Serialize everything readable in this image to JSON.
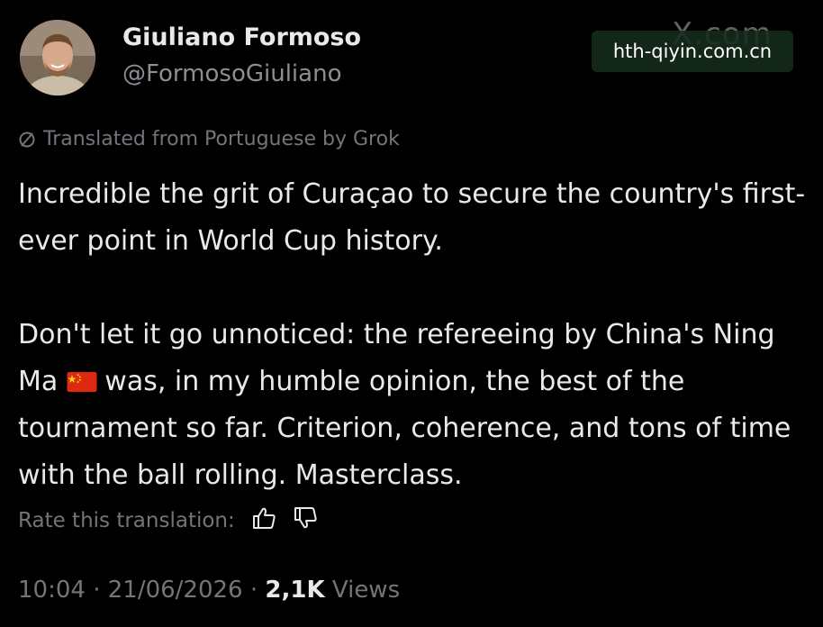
{
  "author": {
    "display_name": "Giuliano Formoso",
    "handle": "@FormosoGiuliano",
    "avatar_icon": "profile-photo"
  },
  "branding": {
    "x_logo": "X.com",
    "watermark": "hth-qiyin.com.cn"
  },
  "translation": {
    "note": "Translated from Portuguese by Grok",
    "icon": "translate-slash-icon"
  },
  "tweet": {
    "paragraph1": "Incredible the grit of Curaçao to secure the country's first-ever point in World Cup history.",
    "paragraph2_before_flag": "Don't let it go unnoticed: the refereeing by China's Ning Ma",
    "flag_icon": "china-flag-emoji",
    "paragraph2_after_flag": "was, in my humble opinion, the best of the tournament so far. Criterion, coherence, and tons of time with the ball rolling. Masterclass."
  },
  "rate": {
    "label": "Rate this translation:",
    "thumbs_up_icon": "thumbs-up-icon",
    "thumbs_down_icon": "thumbs-down-icon"
  },
  "meta": {
    "time": "10:04",
    "separator": "·",
    "date": "21/06/2026",
    "views_count": "2,1K",
    "views_label": "Views"
  },
  "colors": {
    "background": "#000000",
    "primary_text": "#e7e9ea",
    "secondary_text": "#71767b",
    "flag_red": "#de2910",
    "flag_yellow": "#ffde00",
    "watermark_bg": "#162c1c"
  }
}
